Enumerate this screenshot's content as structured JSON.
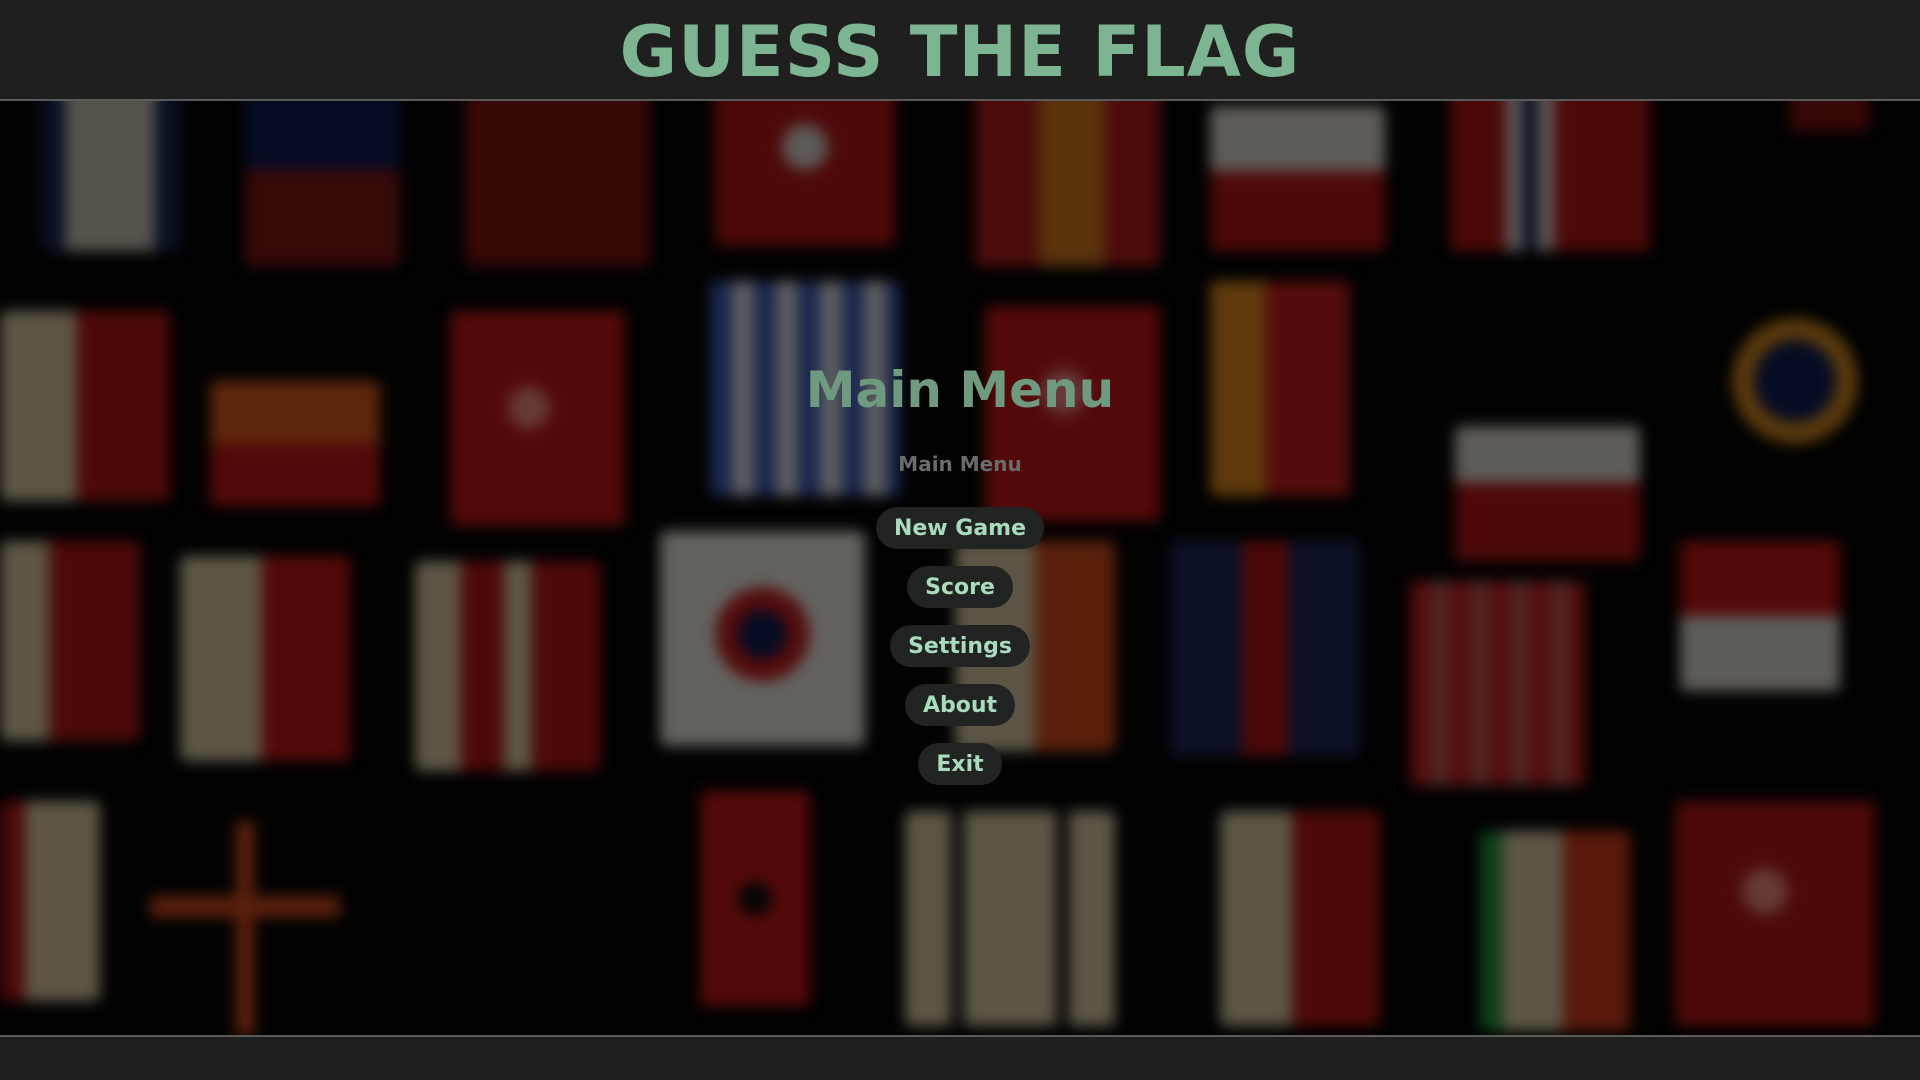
{
  "header": {
    "title": "GUESS THE FLAG"
  },
  "menu": {
    "title": "Main Menu",
    "subtitle": "Main Menu",
    "buttons": {
      "new_game": "New Game",
      "score": "Score",
      "settings": "Settings",
      "about": "About",
      "exit": "Exit"
    }
  },
  "colors": {
    "title_green": "#7db592",
    "button_text": "#a8dcbc",
    "button_bg": "#222423",
    "bar_bg": "#1f1f1f"
  },
  "background": {
    "description_icon": "blurred-flags-background"
  }
}
